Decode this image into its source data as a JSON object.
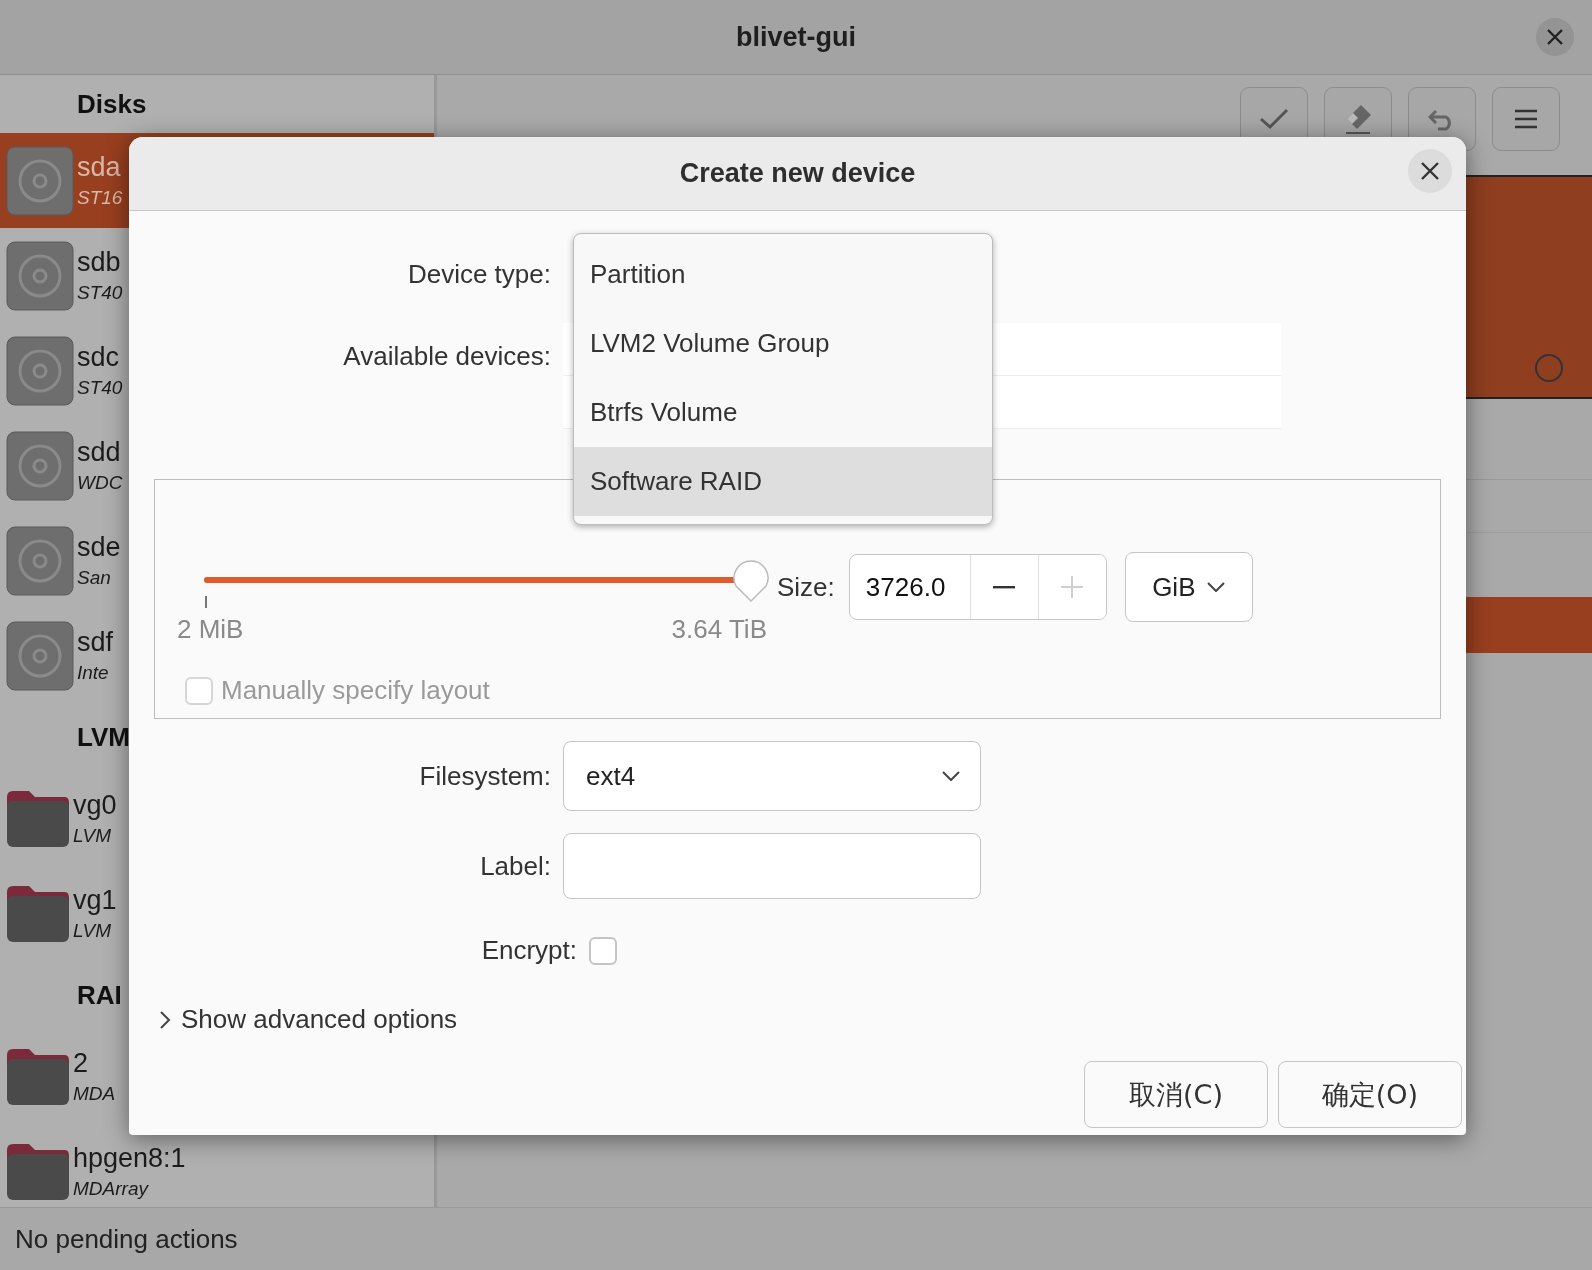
{
  "window": {
    "title": "blivet-gui"
  },
  "sidebar": {
    "sections": [
      {
        "title": "Disks",
        "items": [
          {
            "name": "sda",
            "description": "ST16",
            "kind": "disk",
            "selected": true
          },
          {
            "name": "sdb",
            "description": "ST40",
            "kind": "disk",
            "selected": false
          },
          {
            "name": "sdc",
            "description": "ST40",
            "kind": "disk",
            "selected": false
          },
          {
            "name": "sdd",
            "description": "WDC",
            "kind": "disk",
            "selected": false
          },
          {
            "name": "sde",
            "description": "San",
            "kind": "disk",
            "selected": false
          },
          {
            "name": "sdf",
            "description": "Inte",
            "kind": "disk",
            "selected": false
          }
        ]
      },
      {
        "title": "LVM",
        "items": [
          {
            "name": "vg0",
            "description": "LVM",
            "kind": "group",
            "selected": false
          },
          {
            "name": "vg1",
            "description": "LVM",
            "kind": "group",
            "selected": false
          }
        ]
      },
      {
        "title": "RAI",
        "items": [
          {
            "name": "2",
            "description": "MDA",
            "kind": "group",
            "selected": false
          },
          {
            "name": "hpgen8:1",
            "description": "MDArray",
            "kind": "group",
            "selected": false
          }
        ]
      }
    ]
  },
  "dialog": {
    "title": "Create new device",
    "device_type": {
      "label": "Device type:",
      "options": [
        {
          "label": "Partition",
          "selected": false
        },
        {
          "label": "LVM2 Volume Group",
          "selected": false
        },
        {
          "label": "Btrfs Volume",
          "selected": false
        },
        {
          "label": "Software RAID",
          "selected": true
        }
      ]
    },
    "available_devices": {
      "label": "Available devices:"
    },
    "size": {
      "level": 1,
      "min_label": "2 MiB",
      "max_label": "3.64 TiB",
      "label": "Size:",
      "value": "3726.0",
      "plus_disabled": true,
      "unit": "GiB",
      "manual_layout": {
        "label": "Manually specify layout",
        "checked": false,
        "disabled": true
      }
    },
    "filesystem": {
      "label": "Filesystem:",
      "value": "ext4"
    },
    "label_field": {
      "label": "Label:"
    },
    "encrypt": {
      "label": "Encrypt:",
      "checked": false
    },
    "advanced": {
      "label": "Show advanced options",
      "expanded": false
    },
    "buttons": [
      {
        "label": "取消(C)"
      },
      {
        "label": "确定(O)"
      }
    ]
  },
  "status_bar": "No pending actions"
}
